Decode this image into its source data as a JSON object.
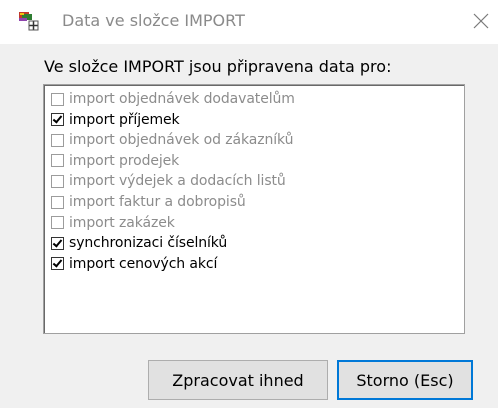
{
  "window": {
    "title": "Data ve složce IMPORT",
    "icon": "app-icon",
    "close_icon": "close-icon"
  },
  "heading": "Ve složce IMPORT jsou připravena data pro:",
  "list": {
    "items": [
      {
        "label": "import objednávek dodavatelům",
        "checked": false,
        "enabled": false
      },
      {
        "label": "import příjemek",
        "checked": true,
        "enabled": true
      },
      {
        "label": "import objednávek od zákazníků",
        "checked": false,
        "enabled": false
      },
      {
        "label": "import prodejek",
        "checked": false,
        "enabled": false
      },
      {
        "label": "import výdejek a dodacích listů",
        "checked": false,
        "enabled": false
      },
      {
        "label": "import faktur a dobropisů",
        "checked": false,
        "enabled": false
      },
      {
        "label": "import zakázek",
        "checked": false,
        "enabled": false
      },
      {
        "label": "synchronizaci číselníků",
        "checked": true,
        "enabled": true
      },
      {
        "label": "import cenových akcí",
        "checked": true,
        "enabled": true
      }
    ]
  },
  "buttons": {
    "process_label": "Zpracovat ihned",
    "cancel_label": "Storno (Esc)"
  },
  "colors": {
    "accent": "#0078d7",
    "disabled_text": "#8c8c8c",
    "dialog_background": "#f0f0f0"
  }
}
